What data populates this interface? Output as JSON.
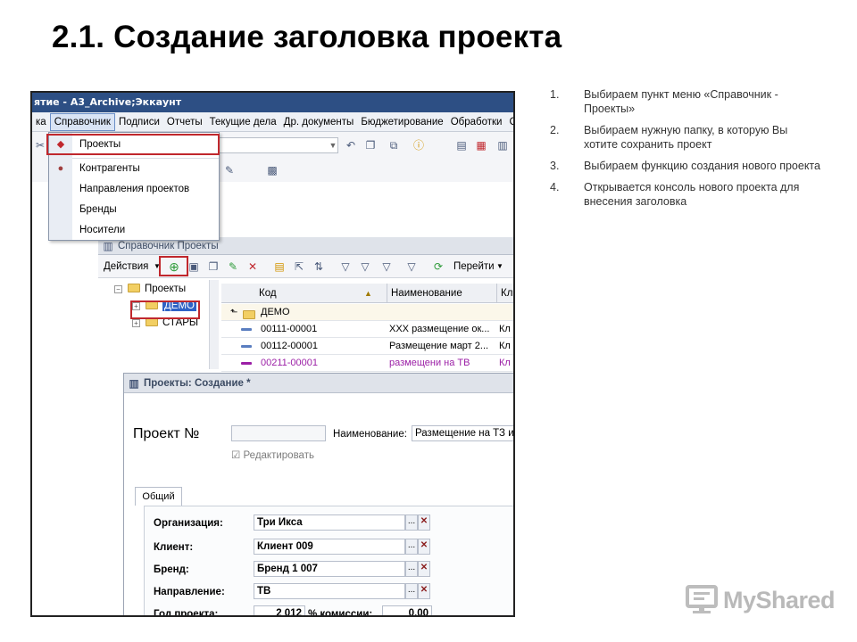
{
  "slide": {
    "title": "2.1. Создание заголовка проекта",
    "steps": [
      {
        "num": "1.",
        "text": "Выбираем пункт меню «Справочник - Проекты»"
      },
      {
        "num": "2.",
        "text": "Выбираем нужную папку, в которую Вы хотите сохранить проект"
      },
      {
        "num": "3.",
        "text": "Выбираем функцию создания нового проекта"
      },
      {
        "num": "4.",
        "text": "Открывается консоль нового проекта для внесения заголовка"
      }
    ],
    "watermark": "MyShared"
  },
  "app": {
    "window_title": "ятие - A3_Archive;Эккаунт",
    "menu": [
      "ка",
      "Справочник",
      "Подписи",
      "Отчеты",
      "Текущие дела",
      "Др. документы",
      "Бюджетирование",
      "Обработки",
      "Сер"
    ],
    "active_menu_index": 1,
    "dropdown": [
      "Проекты",
      "Контрагенты",
      "Направления проектов",
      "Бренды",
      "Носители"
    ],
    "catalog": {
      "title": "Справочник Проекты",
      "actions_label": "Действия",
      "goto_label": "Перейти",
      "tree": [
        "Проекты",
        "ДЕМО",
        "СТАРЫ"
      ],
      "columns": [
        "Код",
        "Наименование",
        "Кл"
      ],
      "parent_row": "ДЕМО",
      "rows": [
        {
          "code": "00111-00001",
          "name": "ХХХ размещение ок...",
          "extra": "Кл"
        },
        {
          "code": "00112-00001",
          "name": "Размещение март 2...",
          "extra": "Кл"
        },
        {
          "code": "00211-00001",
          "name": "размещени на ТВ",
          "extra": "Кл"
        }
      ]
    },
    "create_form": {
      "title": "Проекты: Создание *",
      "project_no_label": "Проект №",
      "name_label": "Наименование:",
      "name_value": "Размещение на ТЗ и",
      "edit_checkbox_label": "Редактировать",
      "tab_label": "Общий",
      "fields": [
        {
          "label": "Организация:",
          "value": "Три Икса"
        },
        {
          "label": "Клиент:",
          "value": "Клиент 009"
        },
        {
          "label": "Бренд:",
          "value": "Бренд 1 007"
        },
        {
          "label": "Направление:",
          "value": "ТВ"
        }
      ],
      "year_label": "Год проекта:",
      "year_value": "2 012",
      "commission_label": "% комиссии:",
      "commission_value": "0,00",
      "select_button": "...",
      "clear_button": "✕"
    }
  },
  "colors": {
    "highlight": "#c0272d",
    "titlebar": "#2d4f84",
    "purple_row": "#9b1fa6"
  }
}
